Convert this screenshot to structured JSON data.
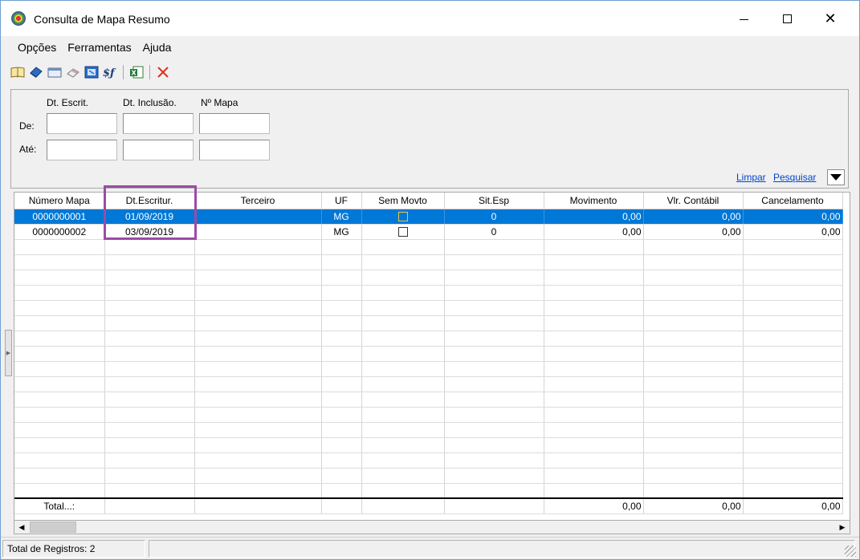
{
  "window": {
    "title": "Consulta de Mapa Resumo",
    "minimize_glyph": "—",
    "close_glyph": "✕"
  },
  "menu": [
    "Opções",
    "Ferramentas",
    "Ajuda"
  ],
  "toolbar": {
    "icons": [
      "book-icon",
      "blue-book-icon",
      "panel-icon",
      "eraser-icon",
      "window-icon",
      "graph-icon",
      "excel-export-icon",
      "delete-icon"
    ]
  },
  "filters": {
    "col1": "Dt. Escrit.",
    "col2": "Dt. Inclusão.",
    "col3": "Nº Mapa",
    "row_from": "De:",
    "row_to": "Até:",
    "clear": "Limpar",
    "search": "Pesquisar"
  },
  "grid": {
    "columns": [
      "Número Mapa",
      "Dt.Escritur.",
      "Terceiro",
      "UF",
      "Sem Movto",
      "Sit.Esp",
      "Movimento",
      "Vlr. Contábil",
      "Cancelamento"
    ],
    "rows": [
      {
        "numero": "0000000001",
        "dt": "01/09/2019",
        "terceiro": "",
        "uf": "MG",
        "sem_movto": false,
        "sit": "0",
        "movimento": "0,00",
        "vlr": "0,00",
        "cancel": "0,00"
      },
      {
        "numero": "0000000002",
        "dt": "03/09/2019",
        "terceiro": "",
        "uf": "MG",
        "sem_movto": false,
        "sit": "0",
        "movimento": "0,00",
        "vlr": "0,00",
        "cancel": "0,00"
      }
    ],
    "total_label": "Total...:",
    "totals": {
      "movimento": "0,00",
      "vlr": "0,00",
      "cancel": "0,00"
    }
  },
  "status": {
    "records": "Total de Registros: 2"
  },
  "colors": {
    "selected_row": "#0078d7",
    "highlight_box": "#9b4ca6",
    "link": "#0044cc"
  }
}
